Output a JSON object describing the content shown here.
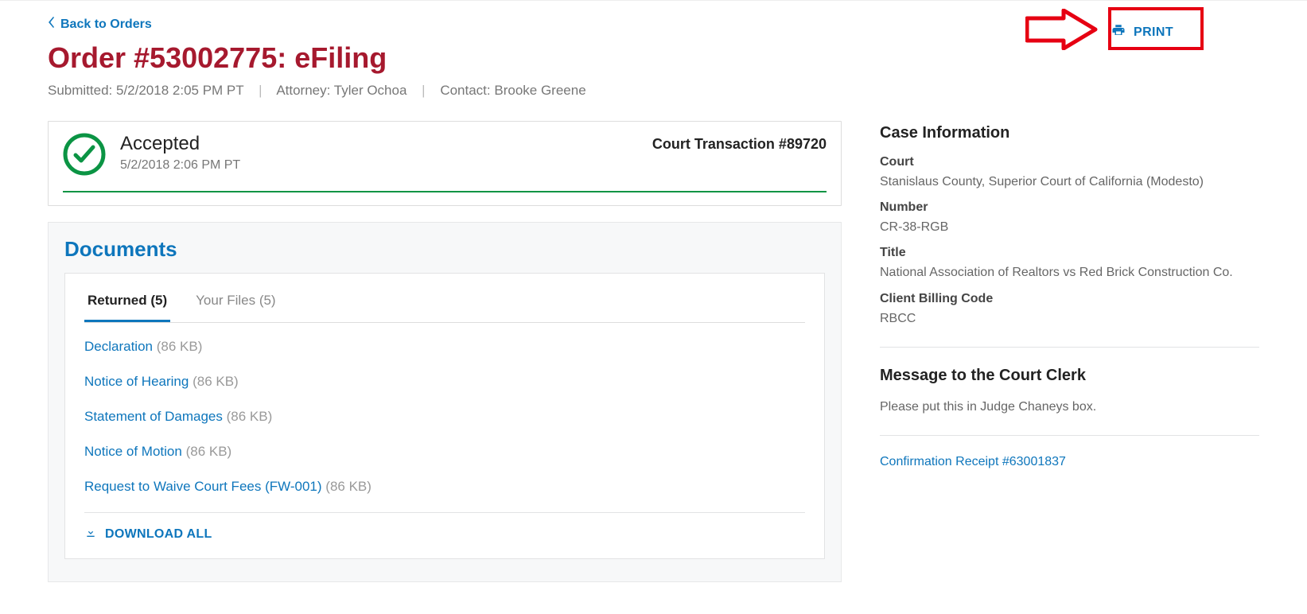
{
  "nav": {
    "back_label": "Back to Orders"
  },
  "header": {
    "title": "Order #53002775: eFiling",
    "submitted_label": "Submitted: ",
    "submitted_value": "5/2/2018 2:05 PM PT",
    "attorney_label": "Attorney: ",
    "attorney_value": "Tyler Ochoa",
    "contact_label": "Contact: ",
    "contact_value": "Brooke Greene"
  },
  "print": {
    "label": "PRINT"
  },
  "status": {
    "title": "Accepted",
    "timestamp": "5/2/2018 2:06 PM PT",
    "transaction_label": "Court Transaction #89720"
  },
  "documents": {
    "heading": "Documents",
    "tabs": [
      {
        "label": "Returned (5)",
        "active": true
      },
      {
        "label": "Your Files (5)",
        "active": false
      }
    ],
    "files": [
      {
        "name": "Declaration",
        "size": "(86 KB)"
      },
      {
        "name": "Notice of Hearing",
        "size": "(86 KB)"
      },
      {
        "name": "Statement of Damages",
        "size": "(86 KB)"
      },
      {
        "name": "Notice of Motion",
        "size": "(86 KB)"
      },
      {
        "name": "Request to Waive Court Fees (FW-001)",
        "size": "(86 KB)"
      }
    ],
    "download_all_label": "DOWNLOAD ALL"
  },
  "case_info": {
    "heading": "Case Information",
    "court_label": "Court",
    "court_value": "Stanislaus County, Superior Court of California (Modesto)",
    "number_label": "Number",
    "number_value": "CR-38-RGB",
    "title_label": "Title",
    "title_value": "National Association of Realtors vs Red Brick Construction Co.",
    "billing_label": "Client Billing Code",
    "billing_value": "RBCC"
  },
  "message": {
    "heading": "Message to the Court Clerk",
    "body": "Please put this in Judge Chaneys box."
  },
  "confirmation": {
    "link_label": "Confirmation Receipt #63001837"
  }
}
